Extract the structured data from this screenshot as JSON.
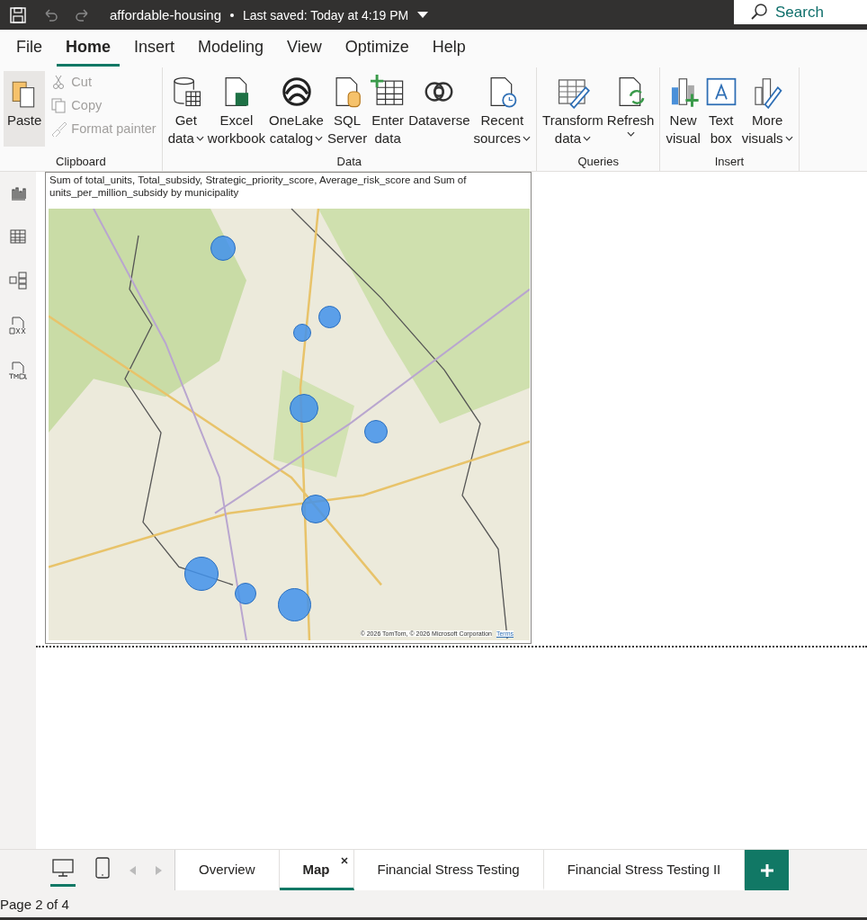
{
  "title_bar": {
    "file_name": "affordable-housing",
    "saved_status": "Last saved: Today at 4:19 PM",
    "search_placeholder": "Search"
  },
  "ribbon_tabs": [
    {
      "label": "File",
      "selected": false
    },
    {
      "label": "Home",
      "selected": true
    },
    {
      "label": "Insert",
      "selected": false
    },
    {
      "label": "Modeling",
      "selected": false
    },
    {
      "label": "View",
      "selected": false
    },
    {
      "label": "Optimize",
      "selected": false
    },
    {
      "label": "Help",
      "selected": false
    }
  ],
  "ribbon_groups": [
    {
      "label": "Clipboard",
      "buttons": [
        {
          "kind": "large",
          "lines": [
            "Paste"
          ],
          "dropdown": false,
          "disabled": false
        },
        {
          "kind": "small",
          "lines": [
            "Cut"
          ],
          "dropdown": false,
          "disabled": true
        },
        {
          "kind": "small",
          "lines": [
            "Copy"
          ],
          "dropdown": false,
          "disabled": true
        },
        {
          "kind": "small",
          "lines": [
            "Format painter"
          ],
          "dropdown": false,
          "disabled": true
        }
      ]
    },
    {
      "label": "Data",
      "buttons": [
        {
          "kind": "large",
          "lines": [
            "Get",
            "data"
          ],
          "dropdown": true,
          "disabled": false
        },
        {
          "kind": "large",
          "lines": [
            "Excel",
            "workbook"
          ],
          "dropdown": false,
          "disabled": false
        },
        {
          "kind": "large",
          "lines": [
            "OneLake",
            "catalog"
          ],
          "dropdown": true,
          "disabled": false
        },
        {
          "kind": "large",
          "lines": [
            "SQL",
            "Server"
          ],
          "dropdown": false,
          "disabled": false
        },
        {
          "kind": "large",
          "lines": [
            "Enter",
            "data"
          ],
          "dropdown": false,
          "disabled": false
        },
        {
          "kind": "large",
          "lines": [
            "Dataverse"
          ],
          "dropdown": false,
          "disabled": false
        },
        {
          "kind": "large",
          "lines": [
            "Recent",
            "sources"
          ],
          "dropdown": true,
          "disabled": false
        }
      ]
    },
    {
      "label": "Queries",
      "buttons": [
        {
          "kind": "large",
          "lines": [
            "Transform",
            "data"
          ],
          "dropdown": true,
          "disabled": false
        },
        {
          "kind": "large",
          "lines": [
            "Refresh"
          ],
          "dropdown": true,
          "disabled": false
        }
      ]
    },
    {
      "label": "Insert",
      "buttons": [
        {
          "kind": "large",
          "lines": [
            "New",
            "visual"
          ],
          "dropdown": false,
          "disabled": false
        },
        {
          "kind": "large",
          "lines": [
            "Text",
            "box"
          ],
          "dropdown": false,
          "disabled": false
        },
        {
          "kind": "large",
          "lines": [
            "More",
            "visuals"
          ],
          "dropdown": true,
          "disabled": false
        }
      ]
    }
  ],
  "visual": {
    "title": "Sum of total_units, Total_subsidy, Strategic_priority_score, Average_risk_score and Sum of units_per_million_subsidy by municipality",
    "attribution": "© 2026 TomTom, © 2026 Microsoft Corporation",
    "terms_link": "Terms"
  },
  "layout_views": [
    {
      "kind": "desktop",
      "selected": true
    },
    {
      "kind": "mobile",
      "selected": false
    }
  ],
  "page_tabs": [
    {
      "label": "Overview",
      "selected": false
    },
    {
      "label": "Map",
      "selected": true
    },
    {
      "label": "Financial Stress Testing",
      "selected": false
    },
    {
      "label": "Financial Stress Testing II",
      "selected": false
    }
  ],
  "status_bar": {
    "page_info": "Page 2 of 4"
  }
}
